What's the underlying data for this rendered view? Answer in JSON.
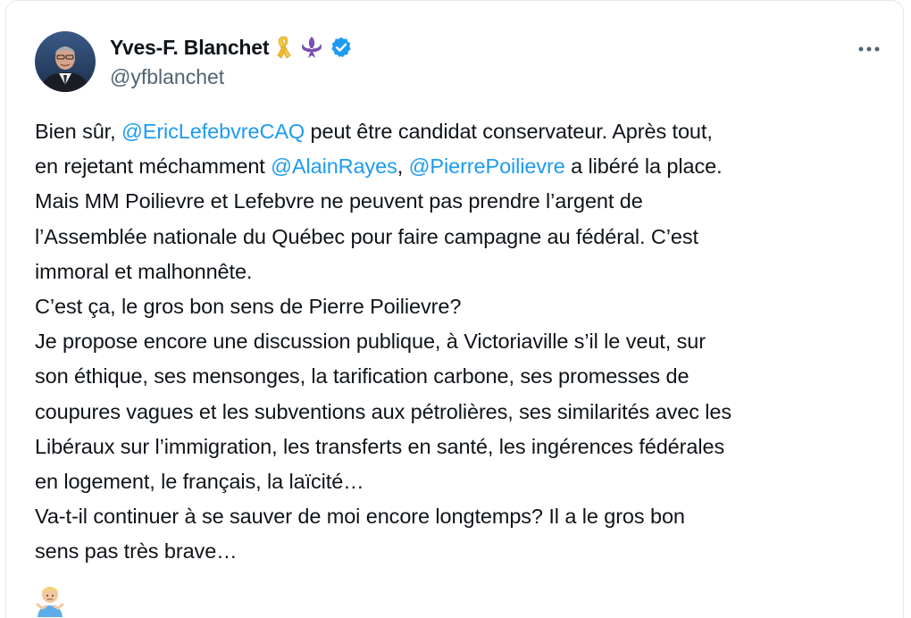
{
  "author": {
    "display_name": "Yves-F. Blanchet",
    "handle": "@yfblanchet",
    "badges": [
      "yellow-ribbon-icon",
      "fleur-de-lis-icon",
      "verified-badge-icon"
    ],
    "verified_color": "#1d9bf0"
  },
  "more_label": "···",
  "link_color": "#1d9bf0",
  "tweet": {
    "line1": {
      "a": "Bien sûr, ",
      "m1": "@EricLefebvreCAQ",
      "b": " peut être candidat conservateur. Après tout,"
    },
    "line2": {
      "a": "en rejetant méchamment ",
      "m1": "@AlainRayes",
      "b": ", ",
      "m2": "@PierrePoilievre",
      "c": " a libéré la place."
    },
    "line3": "Mais MM Poilievre et Lefebvre ne peuvent pas prendre l’argent de",
    "line4": "l’Assemblée nationale du Québec pour faire campagne au fédéral. C’est",
    "line5": "immoral et malhonnête.",
    "line6": "C’est ça, le gros bon sens de Pierre Poilievre?",
    "line7": "Je propose encore une discussion publique, à Victoriaville s’il le veut, sur",
    "line8": "son éthique, ses mensonges, la tarification carbone, ses promesses de",
    "line9": "coupures vagues et les subventions aux pétrolières, ses similarités avec les",
    "line10": "Libéraux sur l’immigration, les transferts en santé, les ingérences fédérales",
    "line11": "en logement, le français, la laïcité…",
    "line12": "Va-t-il continuer à se sauver de moi encore longtemps? Il a le gros bon",
    "line13": "sens pas très brave…",
    "emoji": "person-shrugging-emoji"
  }
}
